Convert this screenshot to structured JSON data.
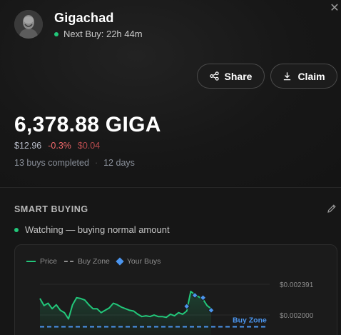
{
  "token": {
    "name": "Gigachad",
    "next_buy": "Next Buy: 22h 44m"
  },
  "actions": {
    "share_label": "Share",
    "claim_label": "Claim"
  },
  "balance": {
    "amount": "6,378.88 GIGA",
    "usd": "$12.96",
    "change_pct": "-0.3%",
    "change_usd": "$0.04",
    "buys": "13 buys completed",
    "separator": "·",
    "days": "12 days"
  },
  "smart_buying": {
    "title": "SMART BUYING",
    "status": "Watching — buying normal amount"
  },
  "colors": {
    "accent_green": "#22c77a",
    "negative_red": "#f0696b",
    "buy_blue": "#4b95ee"
  },
  "icons": [
    "close-icon",
    "share-icon",
    "download-icon",
    "edit-pencil-icon",
    "avatar-image"
  ],
  "chart_data": {
    "type": "line",
    "legend": [
      "Price",
      "Buy Zone",
      "Your Buys"
    ],
    "y_ticks": [
      "$0.002391",
      "$0.002000"
    ],
    "buy_zone_label": "Buy Zone",
    "buy_zone_value": 0.00185,
    "ylim": [
      0.00175,
      0.00245
    ],
    "series": [
      {
        "name": "Price",
        "values": [
          0.00221,
          0.00212,
          0.00215,
          0.00208,
          0.00213,
          0.00206,
          0.00203,
          0.00195,
          0.00213,
          0.00222,
          0.00221,
          0.00219,
          0.00213,
          0.00208,
          0.00208,
          0.00203,
          0.00206,
          0.00209,
          0.00215,
          0.00213,
          0.0021,
          0.00208,
          0.00206,
          0.00205,
          0.00201,
          0.00198,
          0.00199,
          0.00198,
          0.002,
          0.00198,
          0.00198,
          0.00197,
          0.00201,
          0.00199,
          0.00203,
          0.00201,
          0.00205,
          0.0023,
          0.00226,
          0.00223,
          0.0022,
          0.00212,
          0.00208
        ]
      }
    ],
    "buys": [
      {
        "index": 38,
        "value": 0.00225
      },
      {
        "index": 40,
        "value": 0.00222
      },
      {
        "index": 36,
        "value": 0.00211
      },
      {
        "index": 42,
        "value": 0.00206
      }
    ]
  }
}
